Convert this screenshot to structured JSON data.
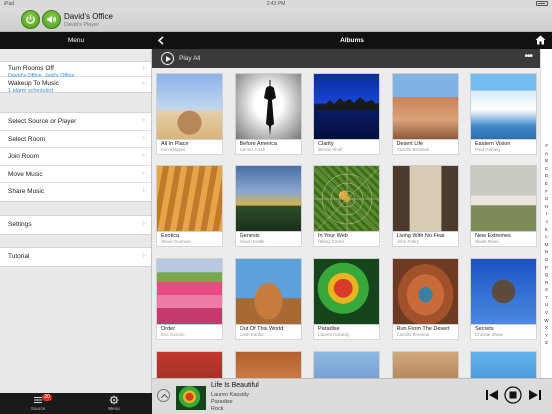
{
  "status": {
    "carrier": "iPad",
    "time": "2:43 PM"
  },
  "room": {
    "title": "David's Office",
    "player": "David's Player"
  },
  "left": {
    "header": "Menu",
    "group1": [
      {
        "label": "Turn Rooms Off",
        "sub": "David's Office, Jodi's Office"
      },
      {
        "label": "Wakeup To Music",
        "sub": "1 alarm scheduled"
      }
    ],
    "group2": [
      {
        "label": "Select Source or Player"
      },
      {
        "label": "Select Room"
      },
      {
        "label": "Join Room"
      },
      {
        "label": "Move Music"
      },
      {
        "label": "Share Music"
      }
    ],
    "group3": [
      {
        "label": "Settings"
      }
    ],
    "group4": [
      {
        "label": "Tutorial"
      }
    ],
    "chevron": "›"
  },
  "bottom_nav": {
    "source_label": "Source",
    "source_badge": "20",
    "menu_label": "Menu"
  },
  "albums": {
    "title": "Albums",
    "play_all": "Play All",
    "more": "•••",
    "items": [
      {
        "title": "All In Place",
        "artist": "Kim Klapper",
        "cover": "c-place"
      },
      {
        "title": "Before America",
        "artist": "Dennis Cash",
        "cover": "c-america"
      },
      {
        "title": "Clarity",
        "artist": "Bernie Sholl",
        "cover": "c-clarity"
      },
      {
        "title": "Desert Life",
        "artist": "Castillo Bromian",
        "cover": "c-desert"
      },
      {
        "title": "Eastern Vision",
        "artist": "Paul Gohleg",
        "cover": "c-eastern"
      },
      {
        "title": "Exotica",
        "artist": "Steve Gunman",
        "cover": "c-exotica"
      },
      {
        "title": "Genesis",
        "artist": "Alison Kettle",
        "cover": "c-genesis"
      },
      {
        "title": "In Your Web",
        "artist": "Hillary Carter",
        "cover": "c-web"
      },
      {
        "title": "Living With No Fear",
        "artist": "John Fabry",
        "cover": "c-living"
      },
      {
        "title": "New Extremes",
        "artist": "Wade Reed",
        "cover": "c-extremes"
      },
      {
        "title": "Order",
        "artist": "Eric Carson",
        "cover": "c-order"
      },
      {
        "title": "Out Of This World",
        "artist": "Leah Kantor",
        "cover": "c-world"
      },
      {
        "title": "Paradise",
        "artist": "Lauren Kassidy",
        "cover": "c-paradise"
      },
      {
        "title": "Run From The Desert",
        "artist": "Castillo Bromian",
        "cover": "c-run"
      },
      {
        "title": "Secrets",
        "artist": "Christie Shaw",
        "cover": "c-secrets"
      }
    ]
  },
  "alphabet": [
    "#",
    "A",
    "B",
    "C",
    "D",
    "E",
    "F",
    "G",
    "H",
    "I",
    "J",
    "K",
    "L",
    "M",
    "N",
    "O",
    "P",
    "Q",
    "R",
    "S",
    "T",
    "U",
    "V",
    "W",
    "X",
    "Y",
    "Z"
  ],
  "now_playing": {
    "title": "Life Is Beautiful",
    "artist": "Lauren Kassidy",
    "album": "Paradise",
    "genre": "Rock"
  }
}
